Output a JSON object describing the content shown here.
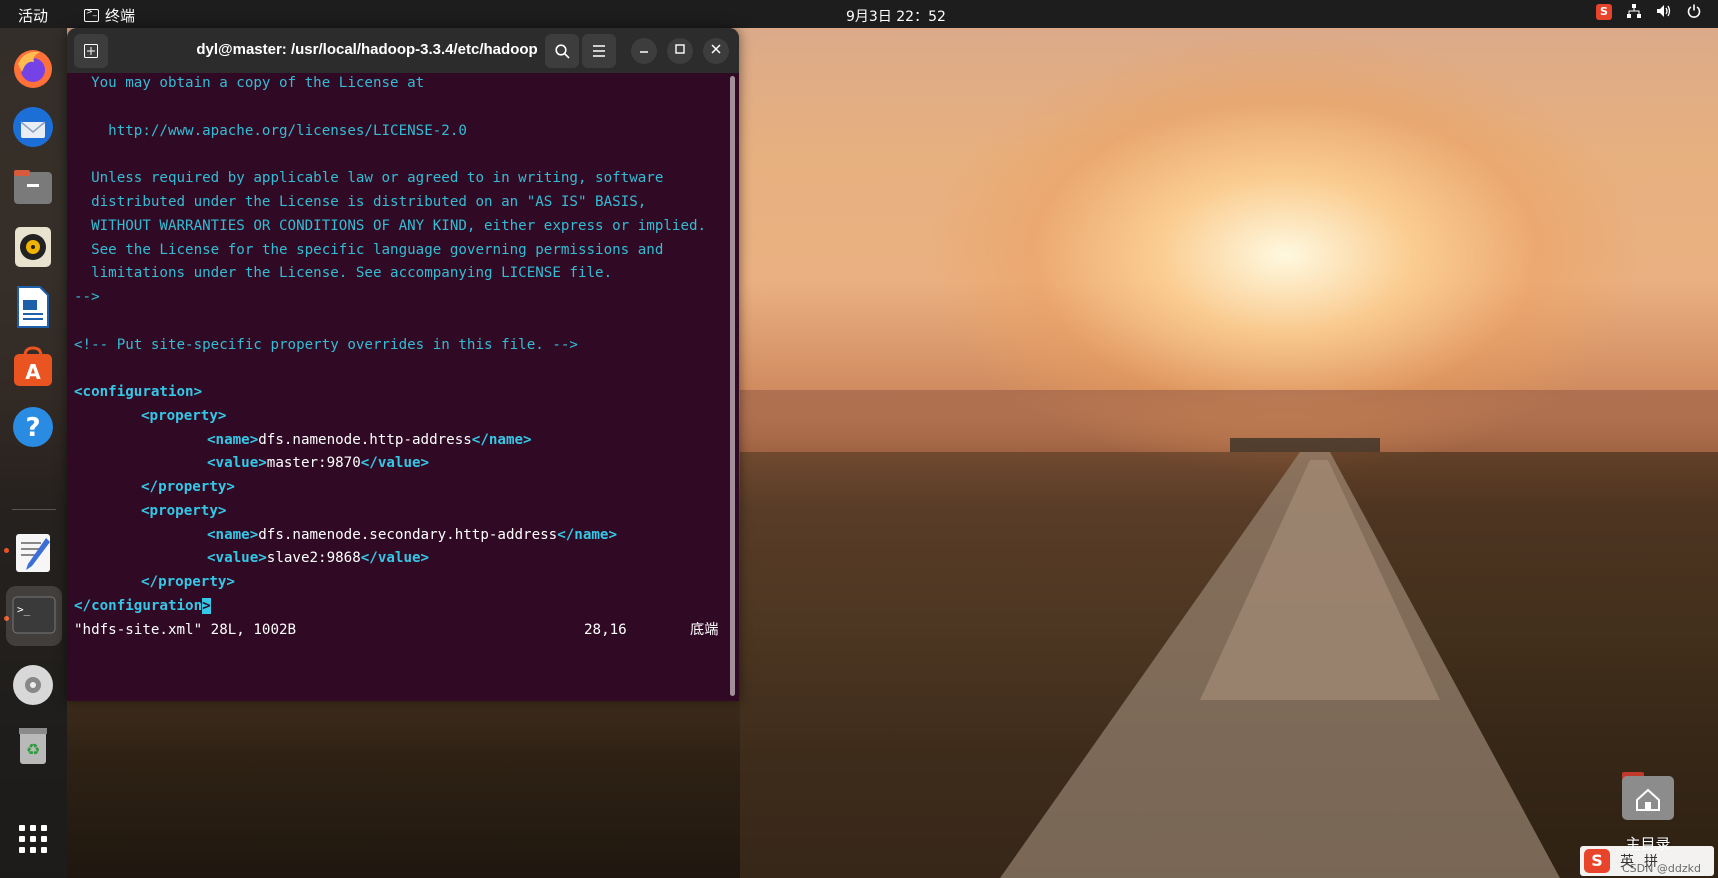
{
  "topbar": {
    "activities": "活动",
    "app_name": "终端",
    "clock": "9月3日  22：52"
  },
  "dock": {
    "items": [
      "firefox-icon",
      "thunderbird-icon",
      "files-icon",
      "rhythmbox-icon",
      "libreoffice-writer-icon",
      "app-center-icon",
      "help-icon",
      "text-editor-icon",
      "terminal-icon",
      "dvd-icon",
      "trash-icon",
      "show-apps-icon"
    ]
  },
  "terminal": {
    "title": "dyl@master: /usr/local/hadoop-3.3.4/etc/hadoop",
    "lines": {
      "l1": "  You may obtain a copy of the License at",
      "l3": "    http://www.apache.org/licenses/LICENSE-2.0",
      "l5": "  Unless required by applicable law or agreed to in writing, software",
      "l6": "  distributed under the License is distributed on an \"AS IS\" BASIS,",
      "l7": "  WITHOUT WARRANTIES OR CONDITIONS OF ANY KIND, either express or implied.",
      "l8": "  See the License for the specific language governing permissions and",
      "l9": "  limitations under the License. See accompanying LICENSE file.",
      "l10": "-->",
      "l12": "<!-- Put site-specific property overrides in this file. -->",
      "l14": "<configuration>",
      "l15": "<property>",
      "l16_open": "<name>",
      "l16_text": "dfs.namenode.http-address",
      "l16_close": "</name>",
      "l17_open": "<value>",
      "l17_text": "master:9870",
      "l17_close": "</value>",
      "l18": "</property>",
      "l19": "<property>",
      "l20_open": "<name>",
      "l20_text": "dfs.namenode.secondary.http-address",
      "l20_close": "</name>",
      "l21_open": "<value>",
      "l21_text": "slave2:9868",
      "l21_close": "</value>",
      "l22": "</property>",
      "l23_main": "</configuration",
      "l23_cursor": ">"
    },
    "status": {
      "file": "\"hdfs-site.xml\" 28L, 1002B",
      "position": "28,16",
      "scroll": "底端"
    }
  },
  "desktop": {
    "home_label": "主目录",
    "watermark": "CSDN @ddzkd"
  },
  "ime": {
    "logo": "S",
    "lang": "英",
    "mode": "拼"
  }
}
